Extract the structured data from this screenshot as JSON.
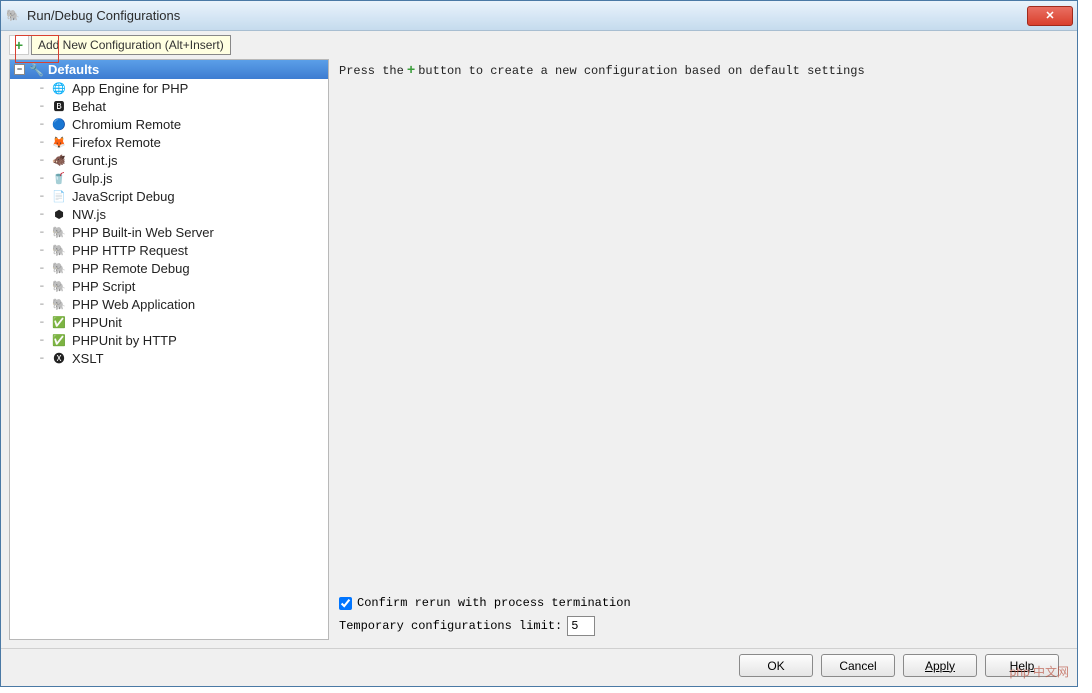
{
  "window": {
    "title": "Run/Debug Configurations"
  },
  "toolbar": {
    "tooltip": "Add New Configuration (Alt+Insert)"
  },
  "tree": {
    "root_label": "Defaults",
    "items": [
      {
        "label": "App Engine for PHP",
        "icon": "🌐"
      },
      {
        "label": "Behat",
        "icon": "🅱"
      },
      {
        "label": "Chromium Remote",
        "icon": "🔵"
      },
      {
        "label": "Firefox Remote",
        "icon": "🦊"
      },
      {
        "label": "Grunt.js",
        "icon": "🐗"
      },
      {
        "label": "Gulp.js",
        "icon": "🥤"
      },
      {
        "label": "JavaScript Debug",
        "icon": "📄"
      },
      {
        "label": "NW.js",
        "icon": "⬢"
      },
      {
        "label": "PHP Built-in Web Server",
        "icon": "🐘"
      },
      {
        "label": "PHP HTTP Request",
        "icon": "🐘"
      },
      {
        "label": "PHP Remote Debug",
        "icon": "🐘"
      },
      {
        "label": "PHP Script",
        "icon": "🐘"
      },
      {
        "label": "PHP Web Application",
        "icon": "🐘"
      },
      {
        "label": "PHPUnit",
        "icon": "✅"
      },
      {
        "label": "PHPUnit by HTTP",
        "icon": "✅"
      },
      {
        "label": "XSLT",
        "icon": "🅧"
      }
    ]
  },
  "right": {
    "hint_before": "Press the ",
    "hint_after": " button to create a new configuration based on default settings",
    "confirm_label": "Confirm rerun with process termination",
    "confirm_checked": true,
    "limit_label": "Temporary configurations limit:",
    "limit_value": "5"
  },
  "buttons": {
    "ok": "OK",
    "cancel": "Cancel",
    "apply": "Apply",
    "help": "Help"
  },
  "watermark": "php 中文网"
}
